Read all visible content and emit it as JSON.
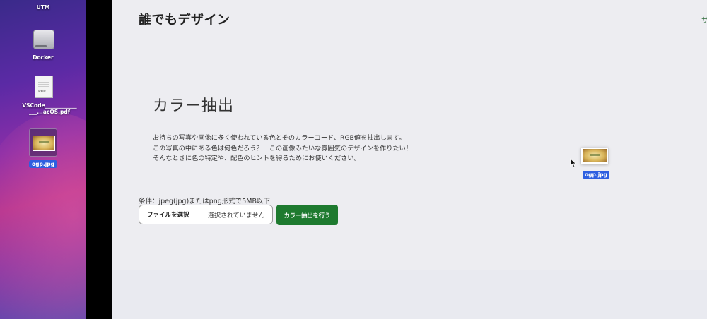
{
  "desktop": {
    "items": [
      {
        "label": "UTM",
        "icon": "utm-app-icon"
      },
      {
        "label": "Docker",
        "icon": "disk-icon"
      },
      {
        "label": "VSCode_______________...acOS.pdf",
        "icon": "pdf-file-icon"
      },
      {
        "label": "ogp.jpg",
        "icon": "image-file-icon",
        "selected": true
      }
    ]
  },
  "header": {
    "site_title": "誰でもデザイン",
    "nav_partial": "サ"
  },
  "main": {
    "heading": "カラー抽出",
    "description": [
      "お持ちの写真や画像に多く使われている色とそのカラーコード、RGB値を抽出します。",
      "この写真の中にある色は何色だろう？　この画像みたいな雰囲気のデザインを作りたい！",
      "そんなときに色の特定や、配色のヒントを得るためにお使いください。"
    ],
    "condition": "条件：jpeg(jpg)またはpng形式で5MB以下",
    "file_input": {
      "button_label": "ファイルを選択",
      "status": "選択されていません"
    },
    "submit_label": "カラー抽出を行う"
  },
  "drag": {
    "file_label": "ogp.jpg"
  },
  "colors": {
    "accent": "#1e7a2f",
    "selection": "#2d5fe0",
    "background": "#ededf1"
  }
}
